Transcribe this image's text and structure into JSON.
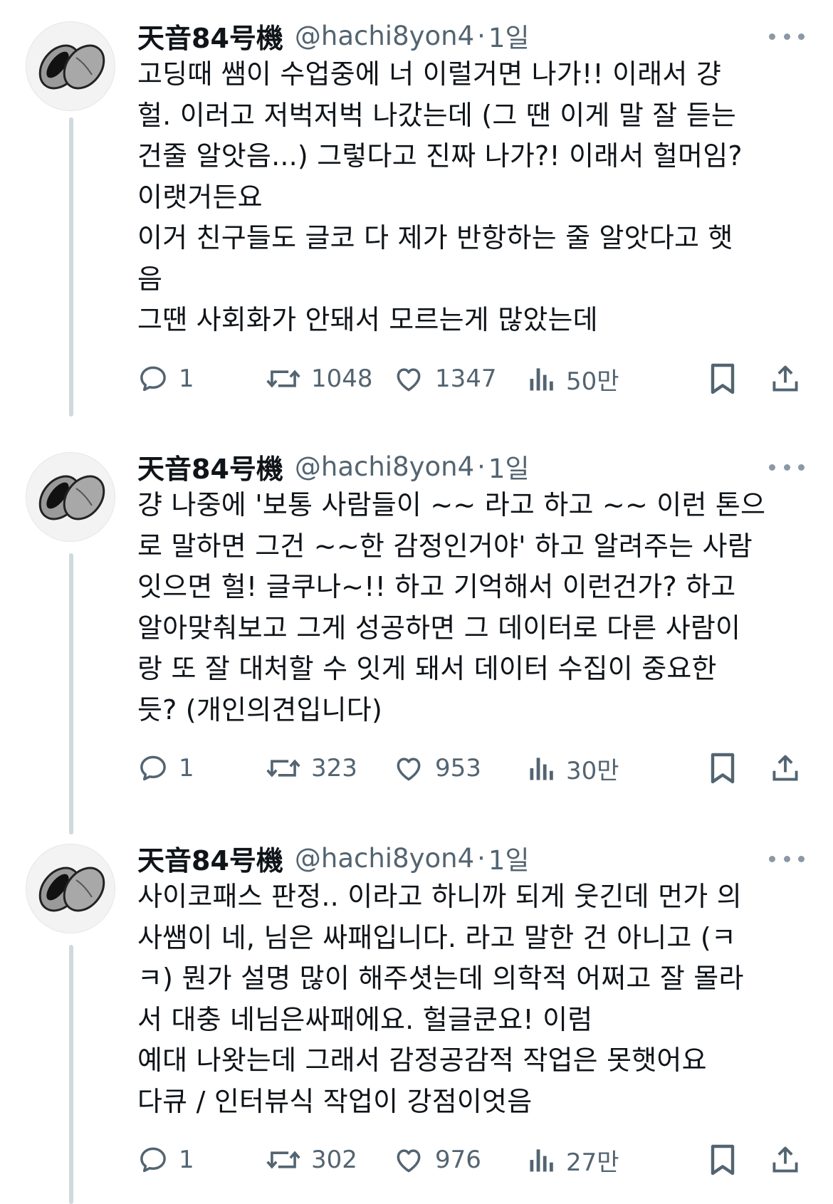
{
  "tweets": [
    {
      "author_name": "天音84号機",
      "handle": "@hachi8yon4",
      "time": "1일",
      "lines": [
        "고딩때 쌤이 수업중에 너 이럴거면 나가!! 이래서 걍",
        "헐. 이러고 저벅저벅 나갔는데 (그 땐 이게 말 잘 듣는",
        "건줄 알앗음...) 그렇다고 진짜 나가?! 이래서 헐머임?",
        "이랫거든요",
        "이거 친구들도 글코 다 제가 반항하는 줄 알앗다고 햇",
        "음",
        "그땐 사회화가 안돼서 모르는게 많았는데"
      ],
      "replies": "1",
      "reposts": "1048",
      "likes": "1347",
      "views": "50만"
    },
    {
      "author_name": "天音84号機",
      "handle": "@hachi8yon4",
      "time": "1일",
      "lines": [
        "걍 나중에 '보통 사람들이 ~~ 라고 하고 ~~ 이런 톤으",
        "로 말하면 그건 ~~한 감정인거야' 하고 알려주는 사람",
        "잇으면 헐! 글쿠나~!! 하고 기억해서 이런건가? 하고",
        "알아맞춰보고 그게 성공하면 그 데이터로 다른 사람이",
        "랑 또 잘 대처할 수 잇게 돼서 데이터 수집이 중요한",
        "듯? (개인의견입니다)"
      ],
      "replies": "1",
      "reposts": "323",
      "likes": "953",
      "views": "30만"
    },
    {
      "author_name": "天音84号機",
      "handle": "@hachi8yon4",
      "time": "1일",
      "lines": [
        "사이코패스 판정.. 이라고 하니까 되게 웃긴데 먼가 의",
        "사쌤이 네, 님은 싸패입니다. 라고 말한 건 아니고 (ㅋ",
        "ㅋ) 뭔가 설명 많이 해주셧는데 의학적 어쩌고 잘 몰라",
        "서 대충 네님은싸패에요. 헐글쿤요! 이럼",
        "예대 나왓는데 그래서 감정공감적 작업은 못햇어요",
        "다큐 / 인터뷰식 작업이 강점이엇음"
      ],
      "replies": "1",
      "reposts": "302",
      "likes": "976",
      "views": "27만"
    }
  ],
  "colors": {
    "text": "#0f1419",
    "secondary": "#536471",
    "thread_line": "#cfd9de"
  },
  "icons": [
    "reply-icon",
    "repost-icon",
    "like-icon",
    "views-icon",
    "bookmark-icon",
    "share-icon",
    "more-icon"
  ]
}
